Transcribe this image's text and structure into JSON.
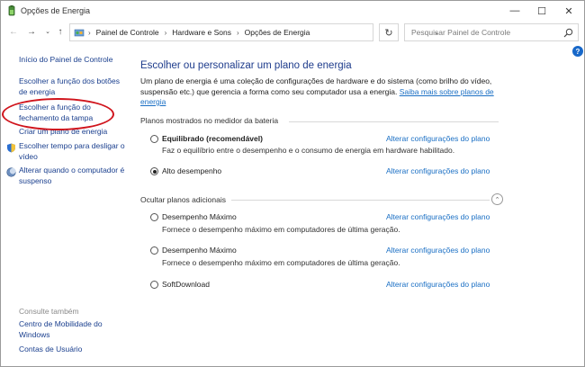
{
  "window": {
    "title": "Opções de Energia",
    "minimize_glyph": "—",
    "maximize_glyph": "☐",
    "close_glyph": "✕"
  },
  "nav": {
    "back_glyph": "←",
    "forward_glyph": "→",
    "recent_glyph": "⌄",
    "up_glyph": "↑",
    "refresh_glyph": "↻",
    "dropdown_glyph": "⌄"
  },
  "breadcrumb": {
    "items": [
      "Painel de Controle",
      "Hardware e Sons",
      "Opções de Energia"
    ],
    "separator": "›"
  },
  "search": {
    "placeholder": "Pesquisar Painel de Controle"
  },
  "help": {
    "glyph": "?"
  },
  "sidebar": {
    "items": [
      {
        "label": "Início do Painel de Controle"
      },
      {
        "label": "Escolher a função dos botões de energia"
      },
      {
        "label": "Escolher a função do fechamento da tampa"
      },
      {
        "label": "Criar um plano de energia"
      },
      {
        "label": "Escolher tempo para desligar o vídeo"
      },
      {
        "label": "Alterar quando o computador é suspenso"
      }
    ],
    "see_also_heading": "Consulte também",
    "see_also": [
      {
        "label": "Centro de Mobilidade do Windows"
      },
      {
        "label": "Contas de Usuário"
      }
    ]
  },
  "main": {
    "title": "Escolher ou personalizar um plano de energia",
    "description": "Um plano de energia é uma coleção de configurações de hardware e do sistema (como brilho do vídeo, suspensão etc.) que gerencia a forma como seu computador usa a energia. ",
    "description_link": "Saiba mais sobre planos de energia",
    "battery_section": "Planos mostrados no medidor da bateria",
    "hidden_section": "Ocultar planos adicionais",
    "change_link": "Alterar configurações do plano",
    "plans": [
      {
        "name": "Equilibrado (recomendável)",
        "desc": "Faz o equilíbrio entre o desempenho e o consumo de energia em hardware habilitado.",
        "selected": false
      },
      {
        "name": "Alto desempenho",
        "desc": "",
        "selected": true
      },
      {
        "name": "Desempenho Máximo",
        "desc": "Fornece o desempenho máximo em computadores de última geração.",
        "selected": false
      },
      {
        "name": "Desempenho Máximo",
        "desc": "Fornece o desempenho máximo em computadores de última geração.",
        "selected": false
      },
      {
        "name": "SoftDownload",
        "desc": "",
        "selected": false
      }
    ],
    "collapse_glyph": "⌃"
  },
  "annotation": {
    "color": "#d0141c"
  },
  "colors": {
    "link": "#1a6fc4",
    "title": "#1e3c8c",
    "nav_link": "#1a3f8e"
  }
}
